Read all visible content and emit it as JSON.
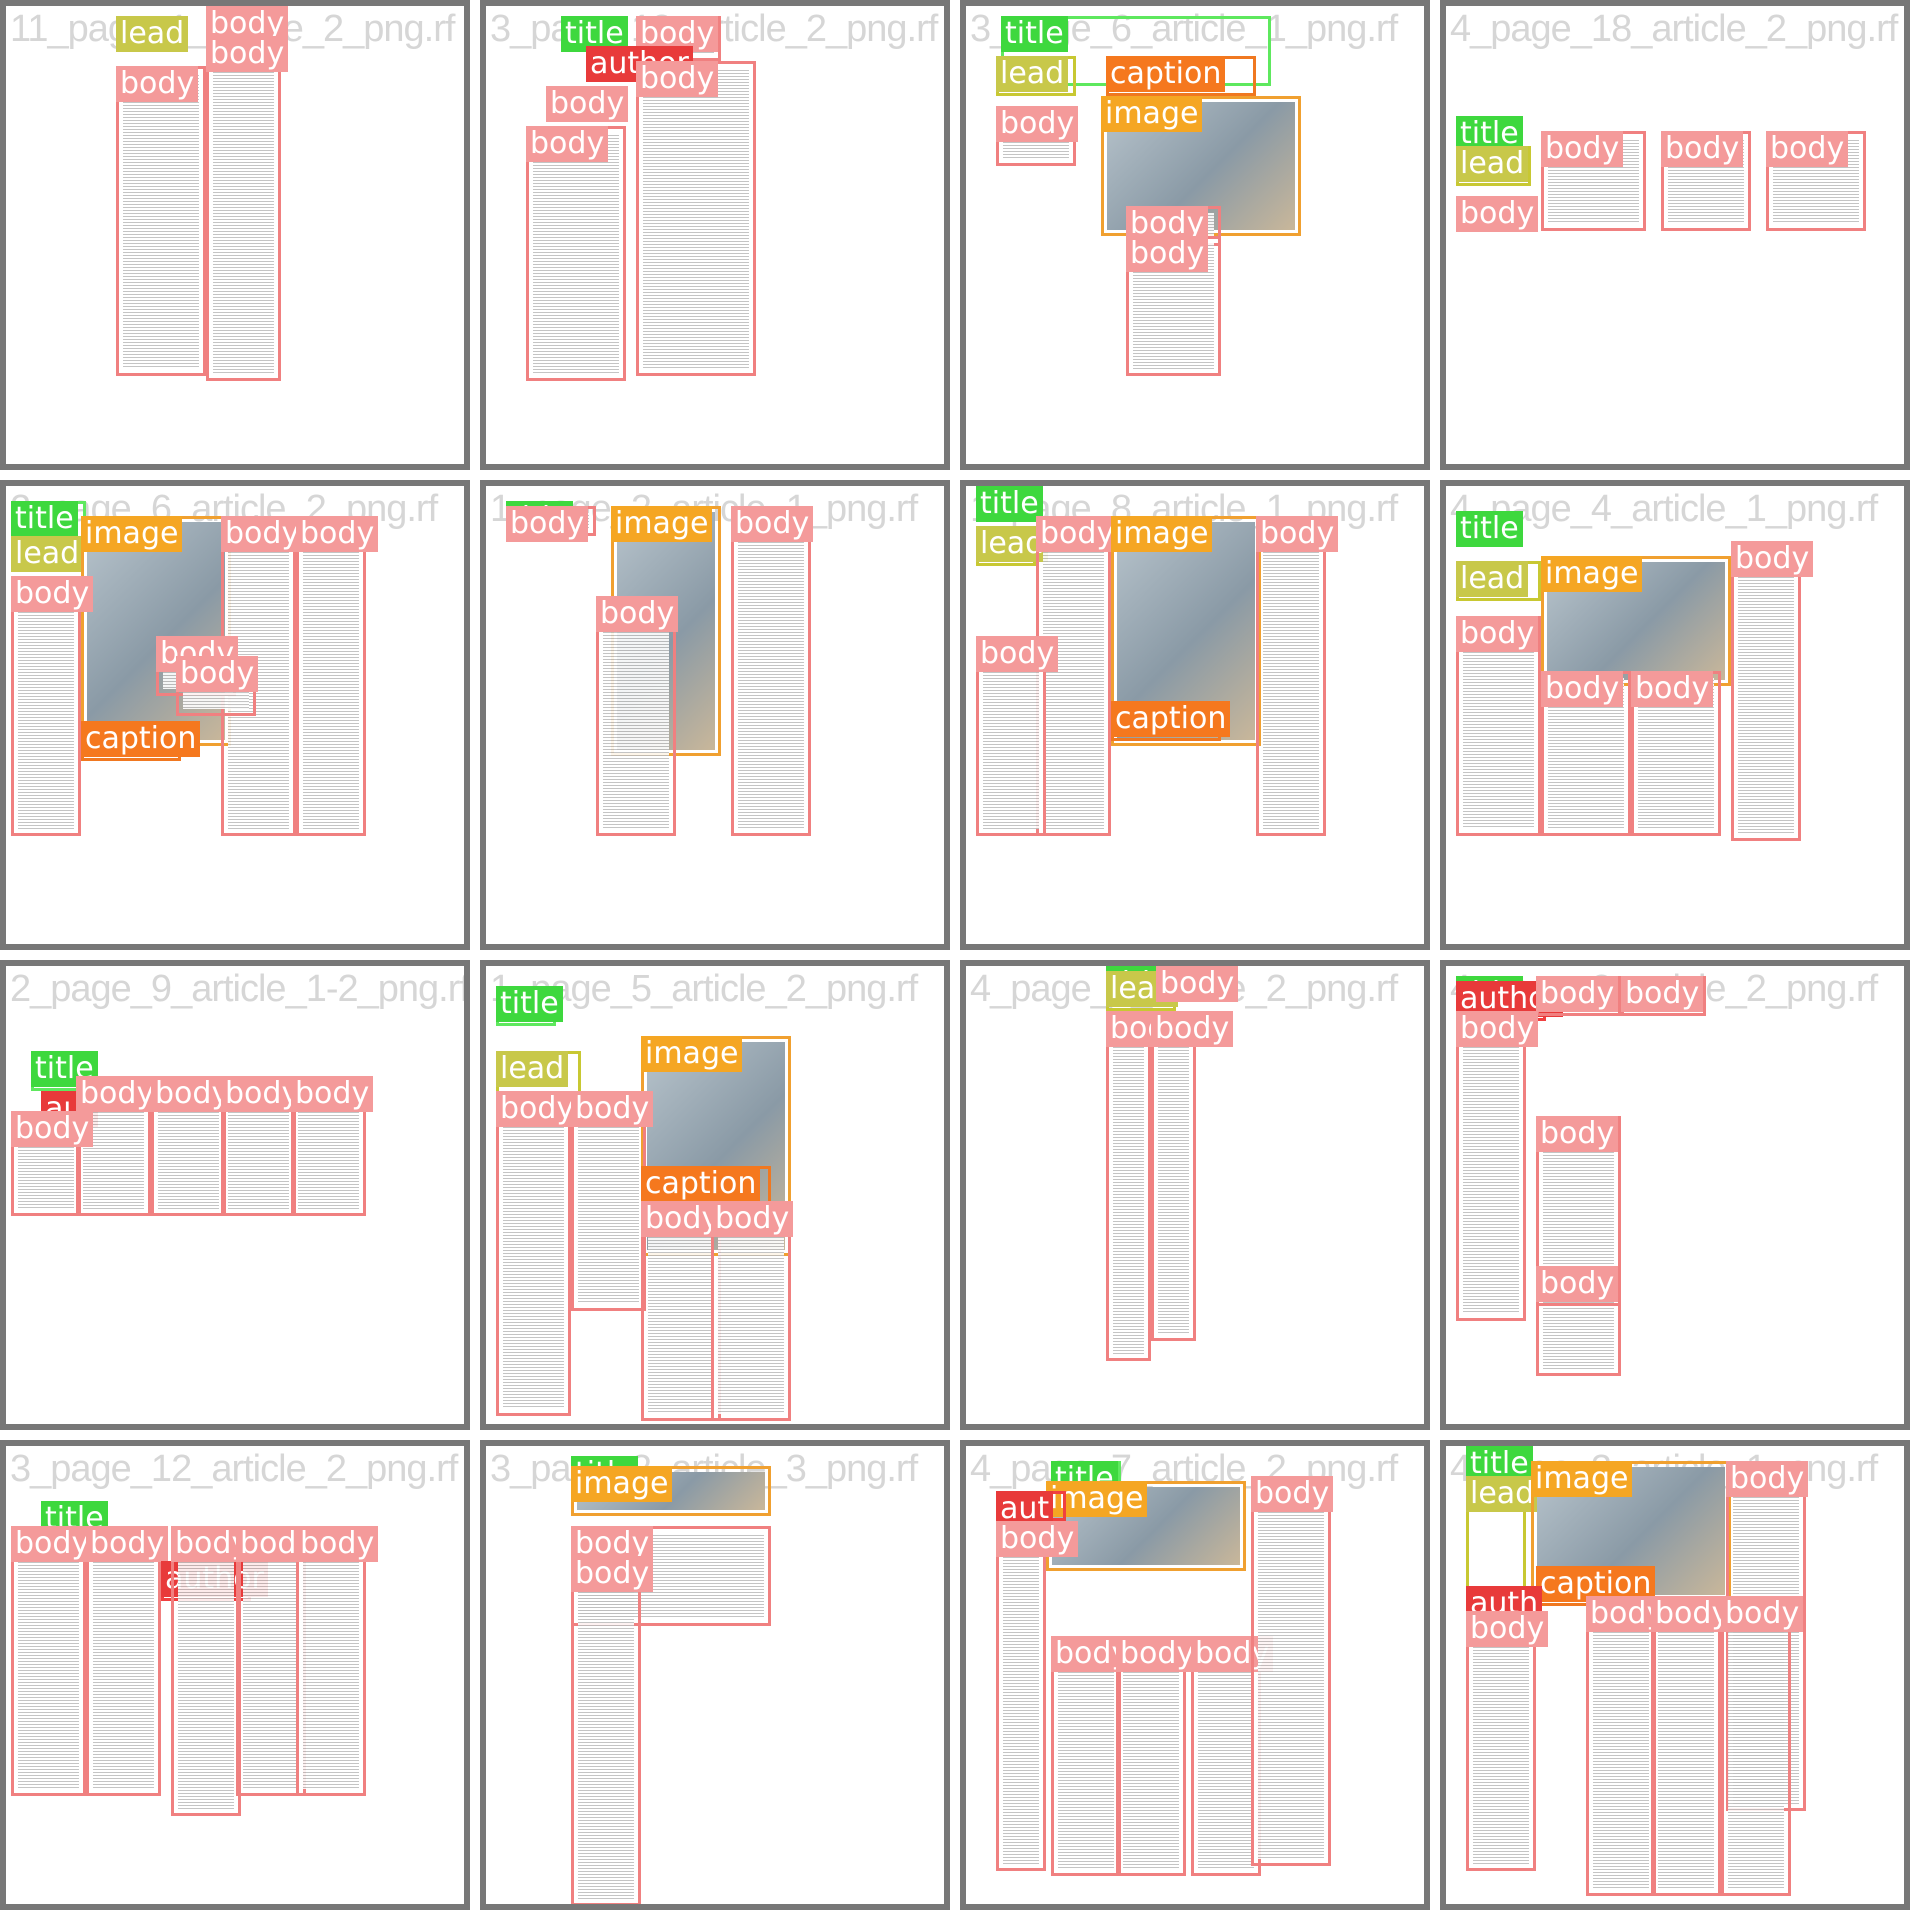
{
  "label_colors": {
    "body": "#f49a9a",
    "title": "#3ed83e",
    "lead": "#c8c84a",
    "image": "#f5a623",
    "caption": "#f5781e",
    "author": "#e83a3a"
  },
  "tiles": [
    {
      "watermark": "11_page_1_article_2_png.rf",
      "regions": [
        {
          "type": "lead",
          "label": "lead"
        },
        {
          "type": "body",
          "label": "body"
        },
        {
          "type": "body",
          "label": "body"
        },
        {
          "type": "body",
          "label": "body"
        }
      ]
    },
    {
      "watermark": "3_page_12_article_2_png.rf",
      "regions": [
        {
          "type": "title",
          "label": "title"
        },
        {
          "type": "body",
          "label": "body"
        },
        {
          "type": "author",
          "label": "author"
        },
        {
          "type": "body",
          "label": "body"
        },
        {
          "type": "body",
          "label": "body"
        },
        {
          "type": "body",
          "label": "body"
        }
      ]
    },
    {
      "watermark": "3_page_6_article_1_png.rf",
      "regions": [
        {
          "type": "title",
          "label": "title"
        },
        {
          "type": "lead",
          "label": "lead"
        },
        {
          "type": "caption",
          "label": "caption"
        },
        {
          "type": "image",
          "label": "image"
        },
        {
          "type": "body",
          "label": "body"
        },
        {
          "type": "body",
          "label": "body"
        },
        {
          "type": "body",
          "label": "body"
        }
      ]
    },
    {
      "watermark": "4_page_18_article_2_png.rf",
      "regions": [
        {
          "type": "title",
          "label": "title"
        },
        {
          "type": "lead",
          "label": "lead"
        },
        {
          "type": "body",
          "label": "body"
        },
        {
          "type": "body",
          "label": "body"
        },
        {
          "type": "body",
          "label": "body"
        },
        {
          "type": "body",
          "label": "body"
        }
      ]
    },
    {
      "watermark": "2_page_6_article_2_png.rf",
      "regions": [
        {
          "type": "title",
          "label": "title"
        },
        {
          "type": "lead",
          "label": "lead"
        },
        {
          "type": "image",
          "label": "image"
        },
        {
          "type": "body",
          "label": "body"
        },
        {
          "type": "body",
          "label": "body"
        },
        {
          "type": "body",
          "label": "body"
        },
        {
          "type": "caption",
          "label": "caption"
        },
        {
          "type": "body",
          "label": "body"
        },
        {
          "type": "body",
          "label": "body"
        }
      ]
    },
    {
      "watermark": "1_page_2_article_1_png.rf",
      "regions": [
        {
          "type": "title",
          "label": "title"
        },
        {
          "type": "body",
          "label": "body"
        },
        {
          "type": "image",
          "label": "image"
        },
        {
          "type": "body",
          "label": "body"
        },
        {
          "type": "body",
          "label": "body"
        }
      ]
    },
    {
      "watermark": "1_page_8_article_1_png.rf",
      "regions": [
        {
          "type": "title",
          "label": "title"
        },
        {
          "type": "lead",
          "label": "lead"
        },
        {
          "type": "body",
          "label": "body"
        },
        {
          "type": "image",
          "label": "image"
        },
        {
          "type": "body",
          "label": "body"
        },
        {
          "type": "body",
          "label": "body"
        },
        {
          "type": "caption",
          "label": "caption"
        }
      ]
    },
    {
      "watermark": "4_page_4_article_1_png.rf",
      "regions": [
        {
          "type": "title",
          "label": "title"
        },
        {
          "type": "lead",
          "label": "lead"
        },
        {
          "type": "image",
          "label": "image"
        },
        {
          "type": "body",
          "label": "body"
        },
        {
          "type": "body",
          "label": "body"
        },
        {
          "type": "body",
          "label": "body"
        },
        {
          "type": "body",
          "label": "body"
        }
      ]
    },
    {
      "watermark": "2_page_9_article_1-2_png.rf",
      "regions": [
        {
          "type": "title",
          "label": "title"
        },
        {
          "type": "author",
          "label": "aut"
        },
        {
          "type": "body",
          "label": "body"
        },
        {
          "type": "body",
          "label": "body"
        },
        {
          "type": "body",
          "label": "body"
        },
        {
          "type": "body",
          "label": "body"
        },
        {
          "type": "body",
          "label": "body"
        }
      ]
    },
    {
      "watermark": "1_page_5_article_2_png.rf",
      "regions": [
        {
          "type": "title",
          "label": "title"
        },
        {
          "type": "lead",
          "label": "lead"
        },
        {
          "type": "image",
          "label": "image"
        },
        {
          "type": "body",
          "label": "body"
        },
        {
          "type": "body",
          "label": "body"
        },
        {
          "type": "caption",
          "label": "caption"
        },
        {
          "type": "body",
          "label": "body"
        },
        {
          "type": "body",
          "label": "body"
        }
      ]
    },
    {
      "watermark": "4_page_1_article_2_png.rf",
      "regions": [
        {
          "type": "title",
          "label": "title"
        },
        {
          "type": "lead",
          "label": "lead"
        },
        {
          "type": "body",
          "label": "body"
        },
        {
          "type": "body",
          "label": "body"
        },
        {
          "type": "body",
          "label": "body"
        }
      ]
    },
    {
      "watermark": "4_page_2_article_2_png.rf",
      "regions": [
        {
          "type": "title",
          "label": "title"
        },
        {
          "type": "author",
          "label": "author"
        },
        {
          "type": "body",
          "label": "body"
        },
        {
          "type": "body",
          "label": "body"
        },
        {
          "type": "body",
          "label": "body"
        },
        {
          "type": "body",
          "label": "body"
        },
        {
          "type": "body",
          "label": "body"
        }
      ]
    },
    {
      "watermark": "3_page_12_article_2_png.rf",
      "regions": [
        {
          "type": "title",
          "label": "title"
        },
        {
          "type": "body",
          "label": "body"
        },
        {
          "type": "body",
          "label": "body"
        },
        {
          "type": "author",
          "label": "author"
        },
        {
          "type": "body",
          "label": "body"
        },
        {
          "type": "body",
          "label": "body"
        },
        {
          "type": "body",
          "label": "body"
        }
      ]
    },
    {
      "watermark": "3_page_2_article_3_png.rf",
      "regions": [
        {
          "type": "title",
          "label": "title"
        },
        {
          "type": "image",
          "label": "image"
        },
        {
          "type": "body",
          "label": "body"
        },
        {
          "type": "body",
          "label": "body"
        }
      ]
    },
    {
      "watermark": "4_page_7_article_2_png.rf",
      "regions": [
        {
          "type": "title",
          "label": "title"
        },
        {
          "type": "image",
          "label": "image"
        },
        {
          "type": "author",
          "label": "aut"
        },
        {
          "type": "body",
          "label": "body"
        },
        {
          "type": "body",
          "label": "body"
        },
        {
          "type": "body",
          "label": "body"
        },
        {
          "type": "body",
          "label": "body"
        },
        {
          "type": "body",
          "label": "body"
        }
      ]
    },
    {
      "watermark": "4_page_3_article_1_png.rf",
      "regions": [
        {
          "type": "title",
          "label": "title"
        },
        {
          "type": "lead",
          "label": "lead"
        },
        {
          "type": "image",
          "label": "image"
        },
        {
          "type": "body",
          "label": "body"
        },
        {
          "type": "caption",
          "label": "caption"
        },
        {
          "type": "author",
          "label": "auth"
        },
        {
          "type": "body",
          "label": "body"
        },
        {
          "type": "body",
          "label": "body"
        },
        {
          "type": "body",
          "label": "body"
        },
        {
          "type": "body",
          "label": "body"
        }
      ]
    }
  ]
}
